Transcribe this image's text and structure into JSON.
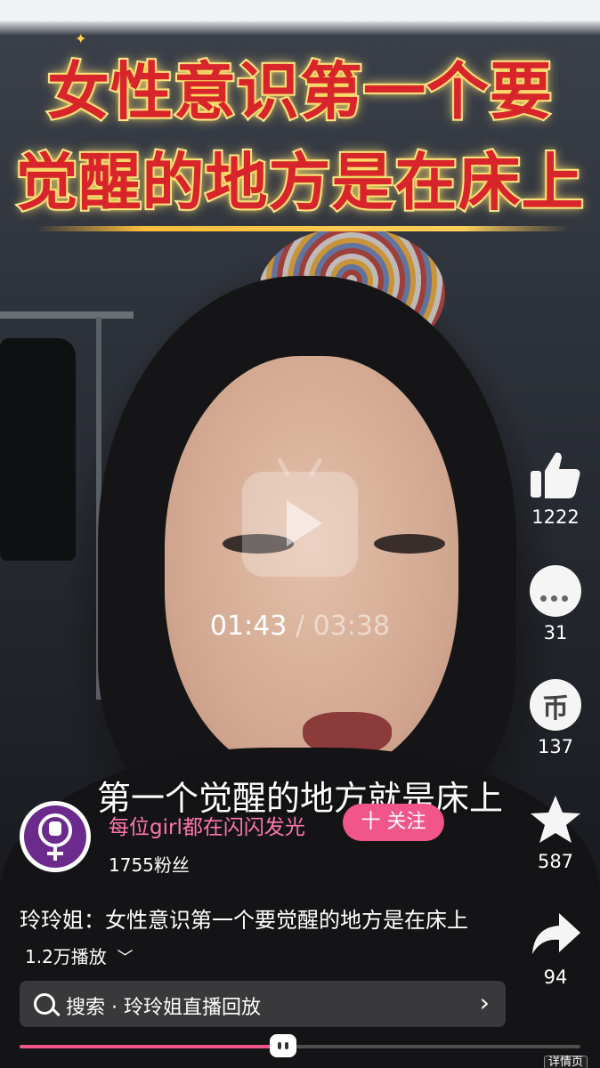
{
  "overlay_title": {
    "line1": "女性意识第一个要",
    "line2": "觉醒的地方是在床上"
  },
  "player": {
    "current_time": "01:43",
    "separator": "/",
    "total_time": "03:38",
    "progress_fraction": 0.47
  },
  "subtitle": "第一个觉醒的地方就是床上",
  "actions": {
    "like_count": "1222",
    "comment_count": "31",
    "coin_count": "137",
    "favorite_count": "587",
    "share_count": "94",
    "coin_glyph": "币"
  },
  "author": {
    "name": "每位girl都在闪闪发光",
    "fans": "1755粉丝",
    "follow_label": "十 关注"
  },
  "description": {
    "text": "玲玲姐：女性意识第一个要觉醒的地方是在床上",
    "plays": "1.2万播放",
    "chevron": "﹀"
  },
  "search": {
    "text": "搜索 · 玲玲姐直播回放",
    "chevron": "›"
  },
  "detail_tag": "详情页",
  "colors": {
    "accent_pink": "#f2558a",
    "author_pink": "#ff77a8",
    "title_red": "#d8242b"
  }
}
